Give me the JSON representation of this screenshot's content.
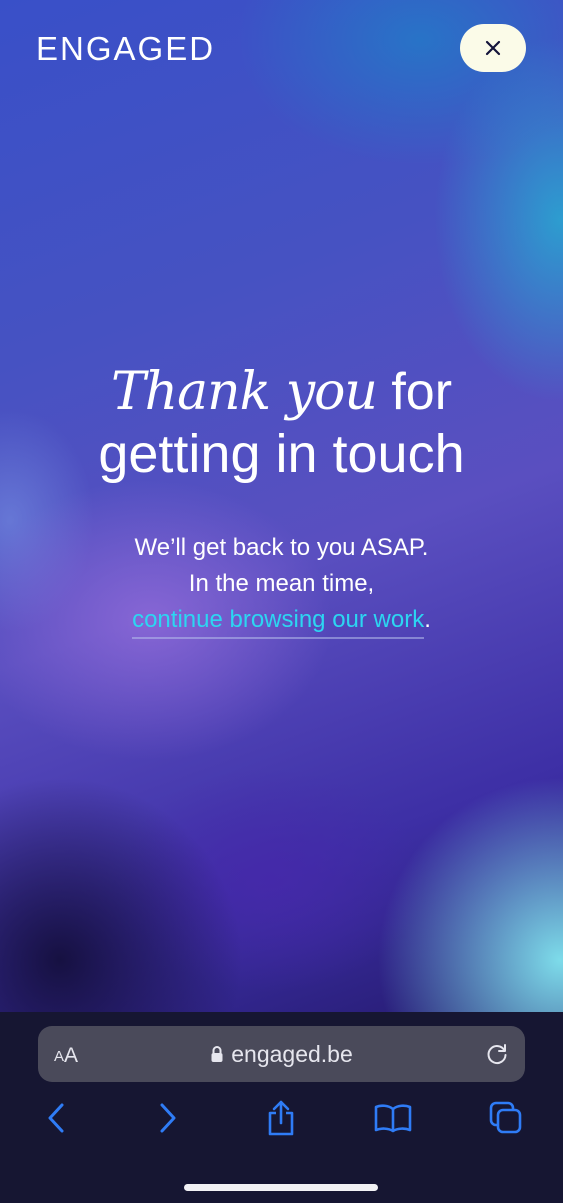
{
  "site": {
    "logo_text": "ENGAGED",
    "close_icon": "close-icon"
  },
  "headline": {
    "serif_text": "Thank you",
    "rest_line1": " for",
    "line2": "getting in touch"
  },
  "message": {
    "line1": "We’ll get back to you ASAP.",
    "line2": "In the mean time,",
    "link_text": "continue browsing our work",
    "trailing": "."
  },
  "browser": {
    "text_size_small": "A",
    "text_size_big": "A",
    "url": "engaged.be",
    "lock_icon": "lock-icon",
    "reload_icon": "reload-icon",
    "toolbar": [
      "back-icon",
      "forward-icon",
      "share-icon",
      "bookmarks-icon",
      "tabs-icon"
    ]
  },
  "colors": {
    "link": "#2cd6f2",
    "close_button_bg": "#fbfbe8",
    "toolbar_icon": "#2f7cf6",
    "browser_bg": "#161632",
    "address_bar_bg": "#4a4a5a"
  }
}
